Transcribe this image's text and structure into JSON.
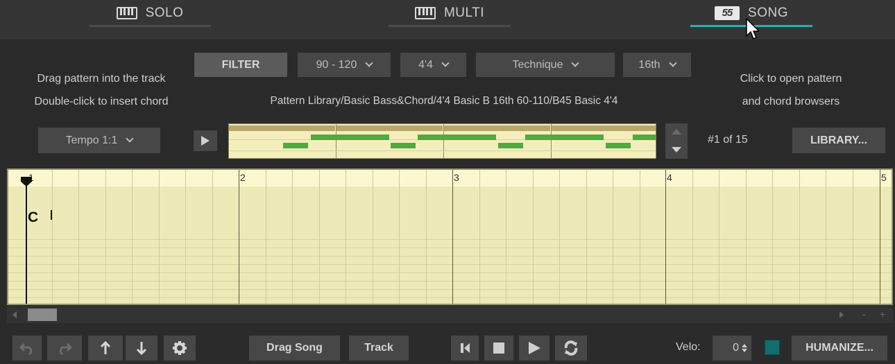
{
  "tabs": [
    {
      "label": "SOLO",
      "icon": "keyboard-icon",
      "active": false
    },
    {
      "label": "MULTI",
      "icon": "keyboard-icon",
      "active": false
    },
    {
      "label": "SONG",
      "icon": "logo-55-icon",
      "active": true
    }
  ],
  "logo_text": "55",
  "hints": {
    "left_line1": "Drag pattern into the track",
    "left_line2": "Double-click to insert chord",
    "right_line1": "Click to open pattern",
    "right_line2": "and chord browsers"
  },
  "filter": {
    "button_label": "FILTER",
    "tempo_range": "90 - 120",
    "time_signature": "4'4",
    "technique": "Technique",
    "resolution": "16th"
  },
  "pattern_path": "Pattern Library/Basic Bass&Chord/4'4 Basic B 16th 60-110/B45 Basic 4'4",
  "tempo_select": "Tempo 1:1",
  "pattern_counter": "#1 of 15",
  "library_button": "LIBRARY...",
  "track": {
    "bar_numbers": [
      "1",
      "2",
      "3",
      "4",
      "5"
    ],
    "chord": "C"
  },
  "zoom": {
    "minus": "-",
    "plus": "+"
  },
  "toolbar": {
    "drag_song": "Drag Song",
    "track": "Track",
    "velo_label": "Velo:",
    "velo_value": "0",
    "humanize": "HUMANIZE..."
  },
  "colors": {
    "accent": "#1fb3bb",
    "note_green": "#4faa3f",
    "track_bg": "#eeeab8",
    "swatch": "#116e6e"
  }
}
